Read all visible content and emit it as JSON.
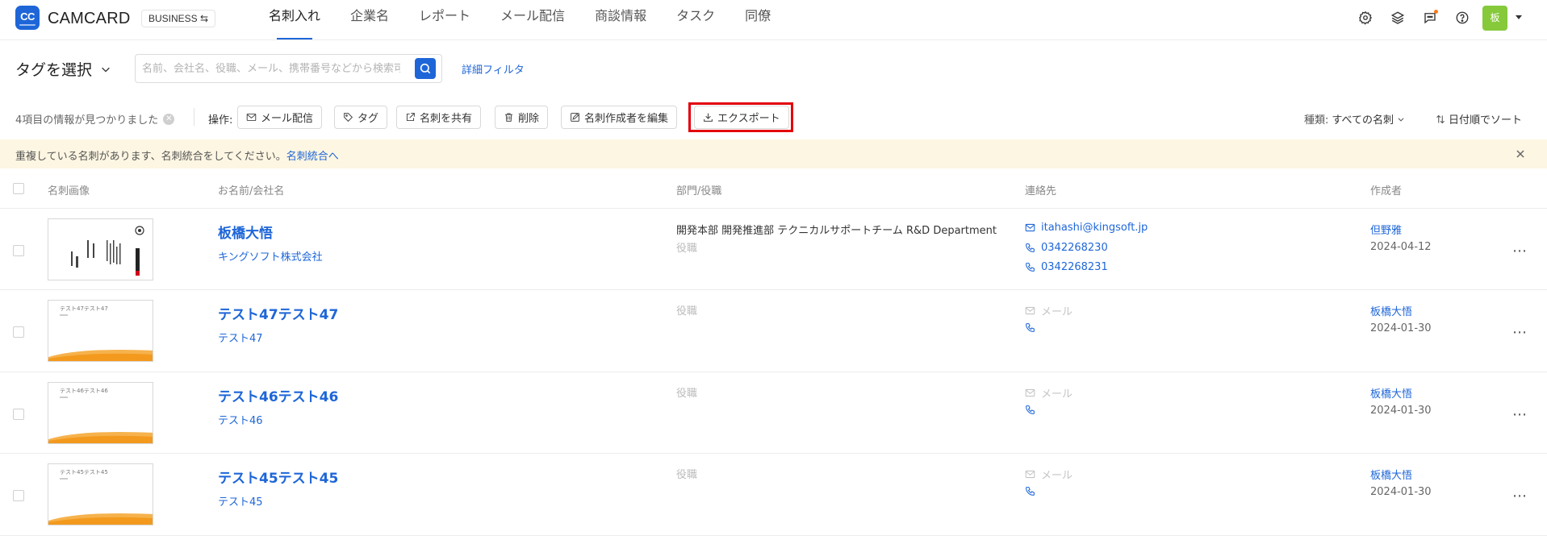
{
  "app": {
    "logo_text": "CC",
    "brand": "CAMCARD",
    "plan": "BUSINESS ⇆"
  },
  "nav": [
    {
      "label": "名刺入れ"
    },
    {
      "label": "企業名"
    },
    {
      "label": "レポート"
    },
    {
      "label": "メール配信"
    },
    {
      "label": "商談情報"
    },
    {
      "label": "タスク"
    },
    {
      "label": "同僚"
    }
  ],
  "top_icons": [
    "gear-icon",
    "layers-icon",
    "chat-icon",
    "help-icon"
  ],
  "user": {
    "avatar_text": "板"
  },
  "filter": {
    "tag_select": "タグを選択",
    "search_placeholder": "名前、会社名、役職、メール、携帯番号などから検索可能",
    "advanced": "詳細フィルタ"
  },
  "toolbar": {
    "results": "4項目の情報が見つかりました",
    "ops_label": "操作:",
    "buttons": {
      "mail": "メール配信",
      "tag": "タグ",
      "share": "名刺を共有",
      "delete": "削除",
      "edit_creator": "名刺作成者を編集",
      "export": "エクスポート"
    },
    "type_label": "種類:",
    "type_value": "すべての名刺",
    "sort": "日付順でソート"
  },
  "notice": {
    "text": "重複している名刺があります、名刺統合をしてください。",
    "link": "名刺統合へ"
  },
  "table": {
    "headers": {
      "image": "名刺画像",
      "name": "お名前/会社名",
      "dept": "部門/役職",
      "contact": "連絡先",
      "creator": "作成者"
    },
    "placeholders": {
      "role": "役職",
      "mail": "メール"
    },
    "rows": [
      {
        "name": "板橋大悟",
        "company": "キングソフト株式会社",
        "dept": "開発本部 開発推進部 テクニカルサポートチーム R&D Department",
        "email": "itahashi@kingsoft.jp",
        "phone1": "0342268230",
        "phone2": "0342268231",
        "creator": "但野雅",
        "date": "2024-04-12"
      },
      {
        "name": "テスト47テスト47",
        "company": "テスト47",
        "card_title": "テスト47テスト47",
        "creator": "板橋大悟",
        "date": "2024-01-30"
      },
      {
        "name": "テスト46テスト46",
        "company": "テスト46",
        "card_title": "テスト46テスト46",
        "creator": "板橋大悟",
        "date": "2024-01-30"
      },
      {
        "name": "テスト45テスト45",
        "company": "テスト45",
        "card_title": "テスト45テスト45",
        "creator": "板橋大悟",
        "date": "2024-01-30"
      }
    ]
  },
  "colors": {
    "accent": "#1e66d8",
    "notice_bg": "#fdf6e2",
    "highlight": "#e3000b",
    "avatar": "#86c93a"
  }
}
